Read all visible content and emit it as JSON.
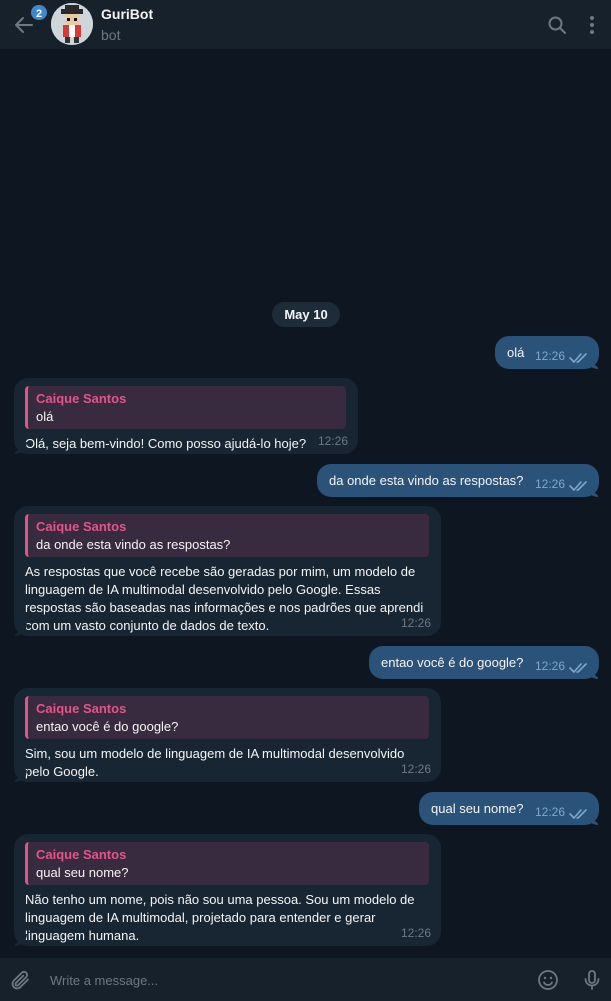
{
  "header": {
    "unread_count": "2",
    "chat_title": "GuriBot",
    "chat_subtitle": "bot"
  },
  "date_label": "May 10",
  "messages": [
    {
      "dir": "out",
      "text": "olá",
      "time": "12:26"
    },
    {
      "dir": "in",
      "reply_name": "Caique Santos",
      "reply_text": "olá",
      "text": "Olá, seja bem-vindo! Como posso ajudá-lo hoje?",
      "time": "12:26"
    },
    {
      "dir": "out",
      "text": "da onde esta vindo as respostas?",
      "time": "12:26"
    },
    {
      "dir": "in",
      "reply_name": "Caique Santos",
      "reply_text": "da onde esta vindo as respostas?",
      "text": "As respostas que você recebe são geradas por mim, um modelo de linguagem de IA multimodal desenvolvido pelo Google. Essas respostas são baseadas nas informações e nos padrões que aprendi com um vasto conjunto de dados de texto.",
      "time": "12:26"
    },
    {
      "dir": "out",
      "text": "entao você é do google?",
      "time": "12:26"
    },
    {
      "dir": "in",
      "reply_name": "Caique Santos",
      "reply_text": "entao você é do google?",
      "text": "Sim, sou um modelo de linguagem de IA multimodal desenvolvido pelo Google.",
      "time": "12:26"
    },
    {
      "dir": "out",
      "text": "qual seu nome?",
      "time": "12:26"
    },
    {
      "dir": "in",
      "reply_name": "Caique Santos",
      "reply_text": "qual seu nome?",
      "text": "Não tenho um nome, pois não sou uma pessoa. Sou um modelo de linguagem de IA multimodal, projetado para entender e gerar linguagem humana.",
      "time": "12:26"
    }
  ],
  "composer": {
    "placeholder": "Write a message..."
  },
  "colors": {
    "background": "#0e1621",
    "outgoing_bubble": "#2b5278",
    "incoming_bubble": "#182533",
    "reply_accent": "#e4548b",
    "header": "#17212b"
  },
  "icons": [
    "back-arrow-icon",
    "search-icon",
    "more-vertical-icon",
    "attach-icon",
    "emoji-icon",
    "microphone-icon",
    "double-check-icon"
  ]
}
